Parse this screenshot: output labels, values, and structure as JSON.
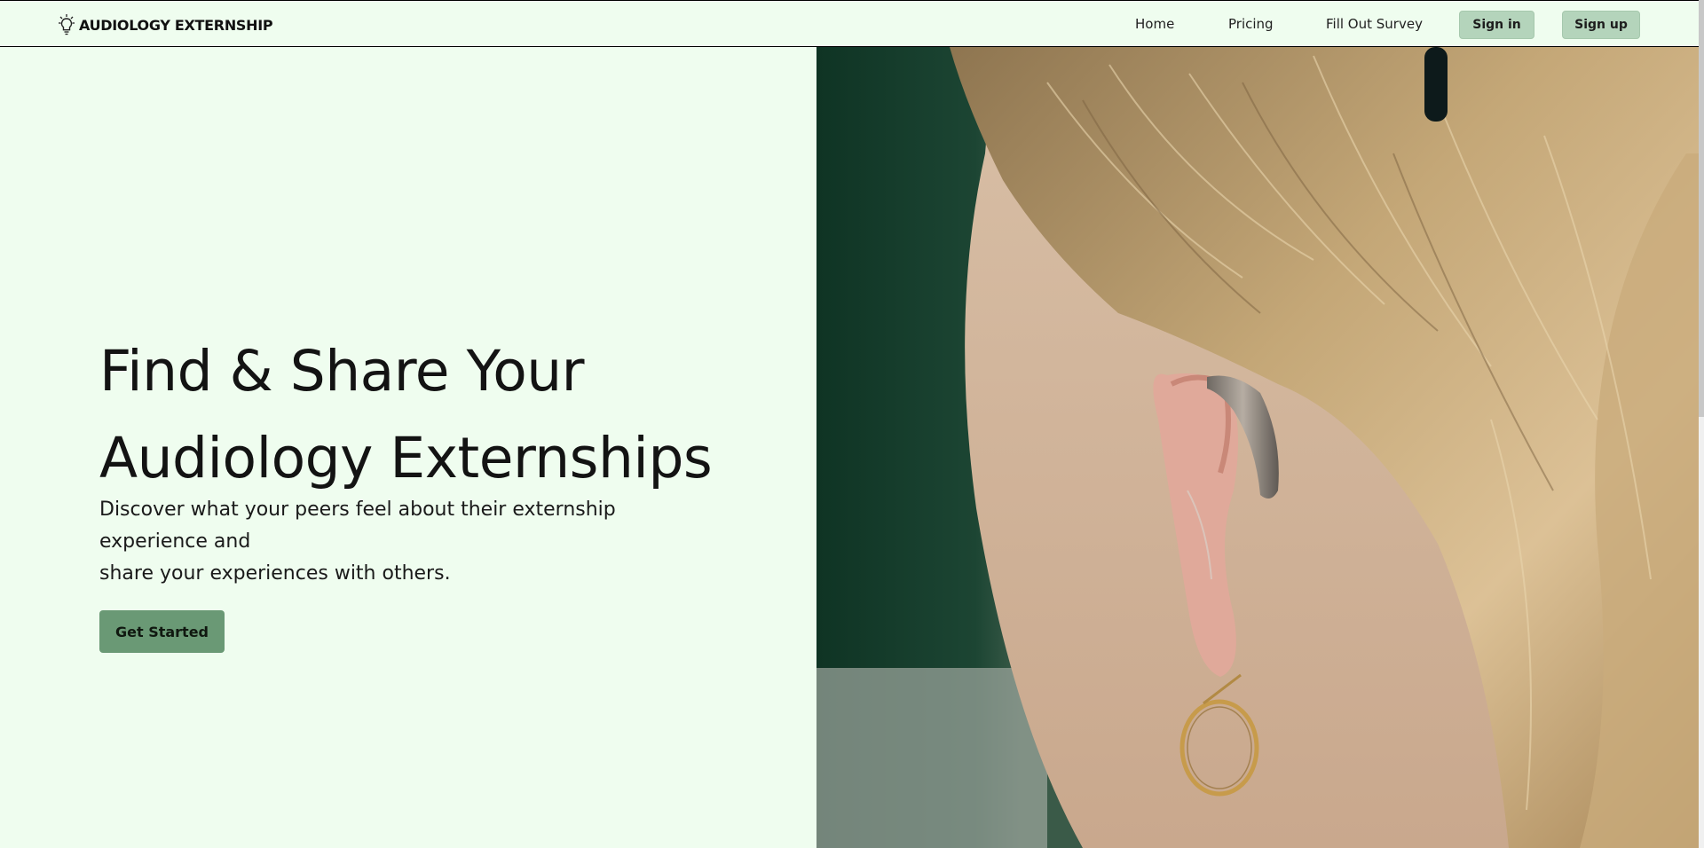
{
  "brand": {
    "name": "AUDIOLOGY EXTERNSHIP",
    "icon": "lightbulb-icon"
  },
  "nav": {
    "links": [
      "Home",
      "Pricing",
      "Fill Out Survey"
    ],
    "sign_in": "Sign in",
    "sign_up": "Sign up"
  },
  "hero": {
    "headline_line1": "Find & Share Your",
    "headline_line2": "Audiology Externships",
    "subtext_line1": "Discover what your peers feel about their externship experience and",
    "subtext_line2": "share your experiences with others.",
    "cta_label": "Get Started",
    "image_description": "close-up of ear with hearing aid"
  },
  "colors": {
    "background": "#effdef",
    "nav_button": "#b4d4bb",
    "cta_button": "#6a9975"
  }
}
